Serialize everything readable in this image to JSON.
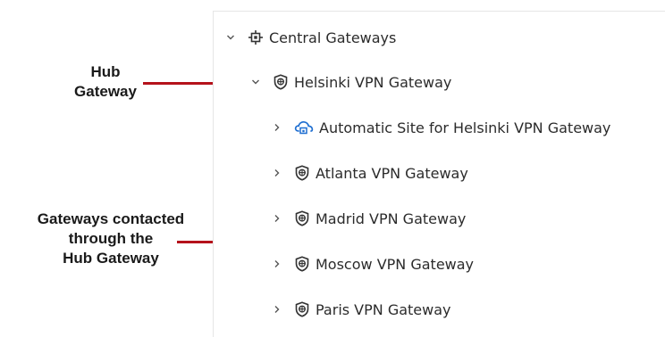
{
  "tree": {
    "items": [
      {
        "label": "Central Gateways",
        "icon": "central-gateways-icon",
        "expanded": true
      },
      {
        "label": "Helsinki VPN Gateway",
        "icon": "vpn-gateway-icon",
        "expanded": true
      },
      {
        "label": "Automatic Site for Helsinki VPN Gateway",
        "icon": "automatic-site-icon",
        "expanded": false
      },
      {
        "label": "Atlanta VPN Gateway",
        "icon": "vpn-gateway-icon",
        "expanded": false
      },
      {
        "label": "Madrid VPN Gateway",
        "icon": "vpn-gateway-icon",
        "expanded": false
      },
      {
        "label": "Moscow VPN Gateway",
        "icon": "vpn-gateway-icon",
        "expanded": false
      },
      {
        "label": "Paris VPN Gateway",
        "icon": "vpn-gateway-icon",
        "expanded": false
      }
    ]
  },
  "annotations": {
    "hub_line1": "Hub",
    "hub_line2": "Gateway",
    "contacted_line1": "Gateways contacted",
    "contacted_line2": "through the",
    "contacted_line3": "Hub Gateway"
  },
  "colors": {
    "annotation_line": "#b5121b",
    "site_icon_accent": "#1f6fd1",
    "icon_dark": "#333333"
  }
}
